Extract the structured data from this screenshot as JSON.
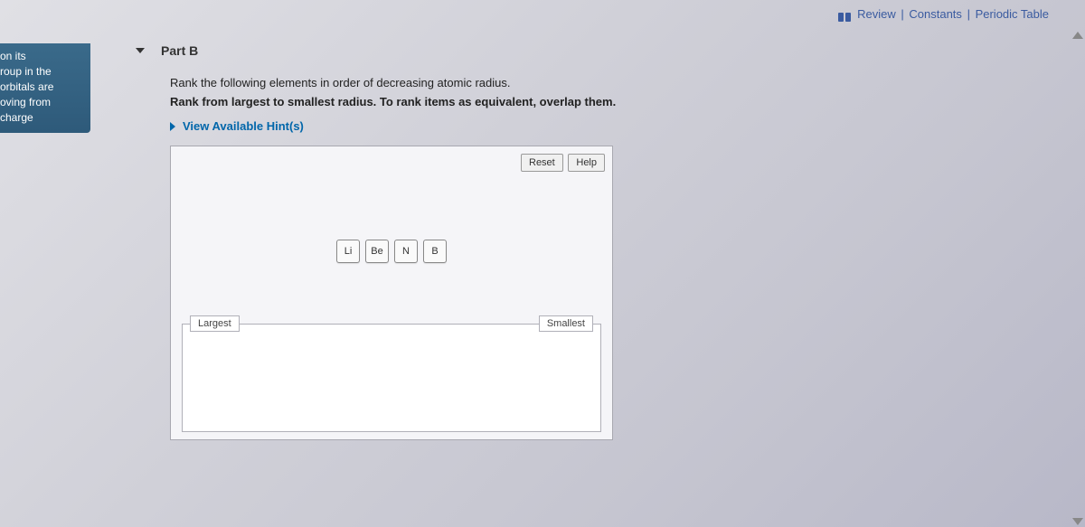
{
  "top_nav": {
    "review": "Review",
    "constants": "Constants",
    "periodic": "Periodic Table"
  },
  "left_fragment": {
    "l1": "on its",
    "l2": "roup in the",
    "l3": "orbitals are",
    "l4": "oving from",
    "l5": "charge"
  },
  "part": {
    "label": "Part B",
    "instr1": "Rank the following elements in order of decreasing atomic radius.",
    "instr2": "Rank from largest to smallest radius. To rank items as equivalent, overlap them.",
    "hints": "View Available Hint(s)"
  },
  "widget": {
    "reset": "Reset",
    "help": "Help",
    "chips": [
      "Li",
      "Be",
      "N",
      "B"
    ],
    "left_label": "Largest",
    "right_label": "Smallest"
  }
}
